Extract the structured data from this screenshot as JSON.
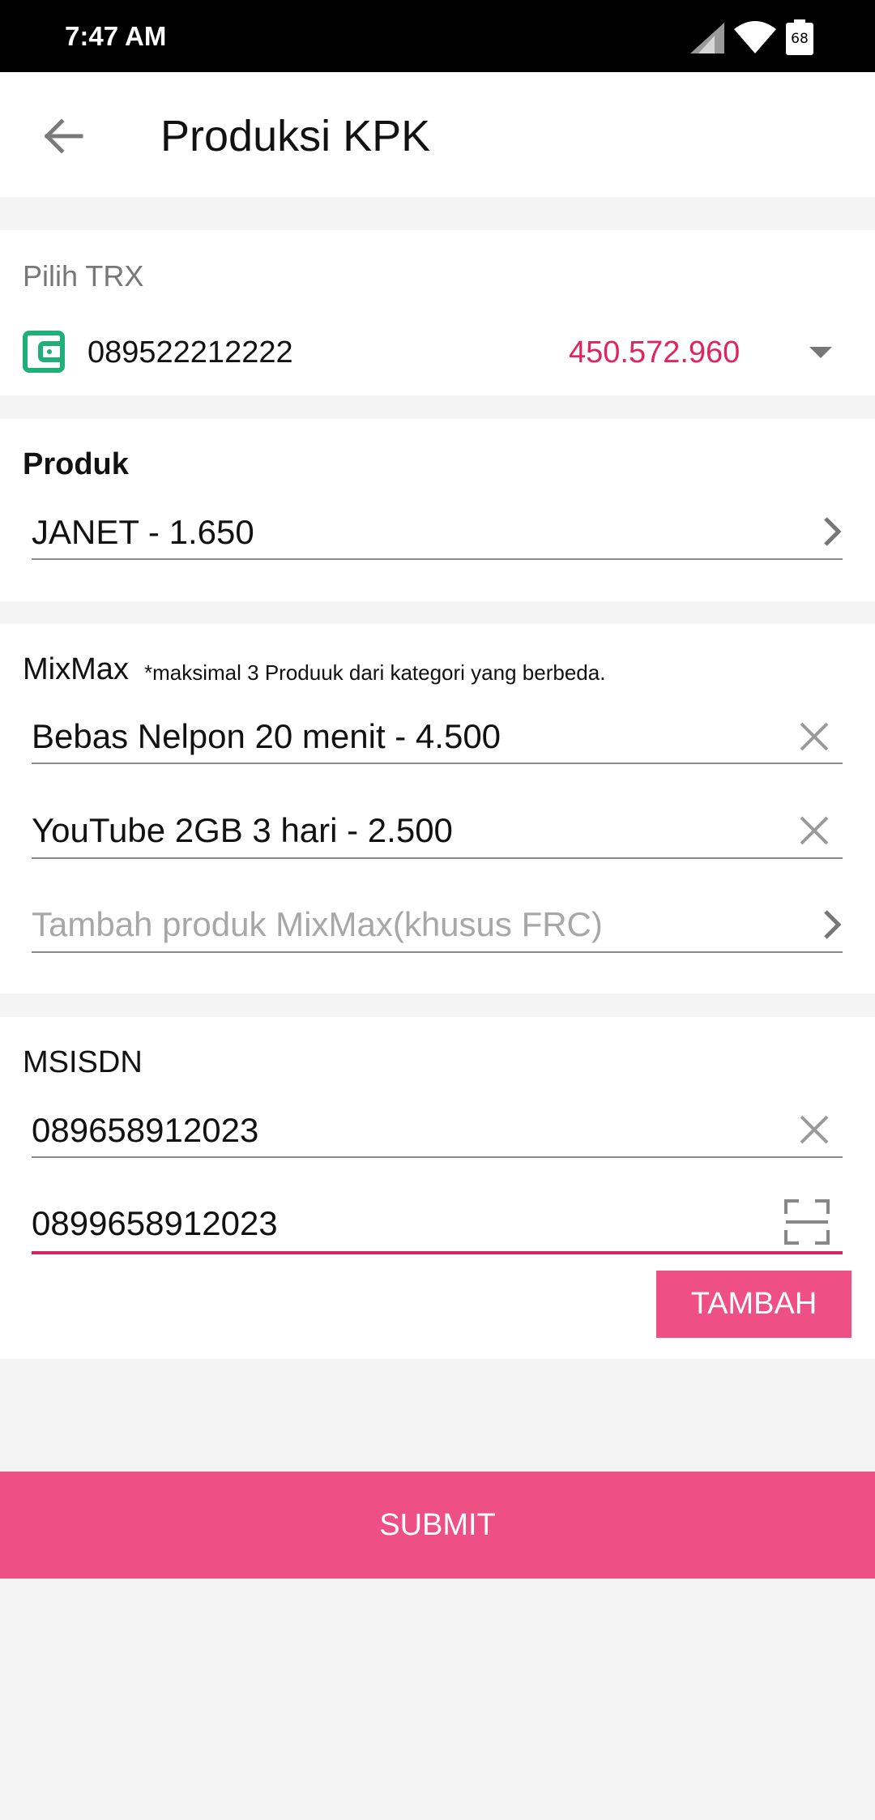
{
  "status_bar": {
    "time": "7:47 AM",
    "battery": "68"
  },
  "header": {
    "title": "Produksi KPK"
  },
  "trx": {
    "label": "Pilih TRX",
    "number": "089522212222",
    "balance": "450.572.960"
  },
  "produk": {
    "label": "Produk",
    "value": "JANET - 1.650"
  },
  "mixmax": {
    "label": "MixMax",
    "note": "*maksimal 3 Produuk dari kategori yang berbeda.",
    "items": [
      {
        "value": "Bebas Nelpon 20 menit - 4.500"
      },
      {
        "value": "YouTube 2GB 3 hari - 2.500"
      }
    ],
    "add_placeholder": "Tambah produk MixMax(khusus FRC)"
  },
  "msisdn": {
    "label": "MSISDN",
    "entries": [
      {
        "value": "089658912023"
      }
    ],
    "input_value": "0899658912023",
    "add_label": "TAMBAH"
  },
  "submit_label": "SUBMIT",
  "colors": {
    "accent": "#ee4f85",
    "accent_dark": "#d7245e",
    "wallet": "#1fb07a",
    "background": "#f4f4f4"
  }
}
